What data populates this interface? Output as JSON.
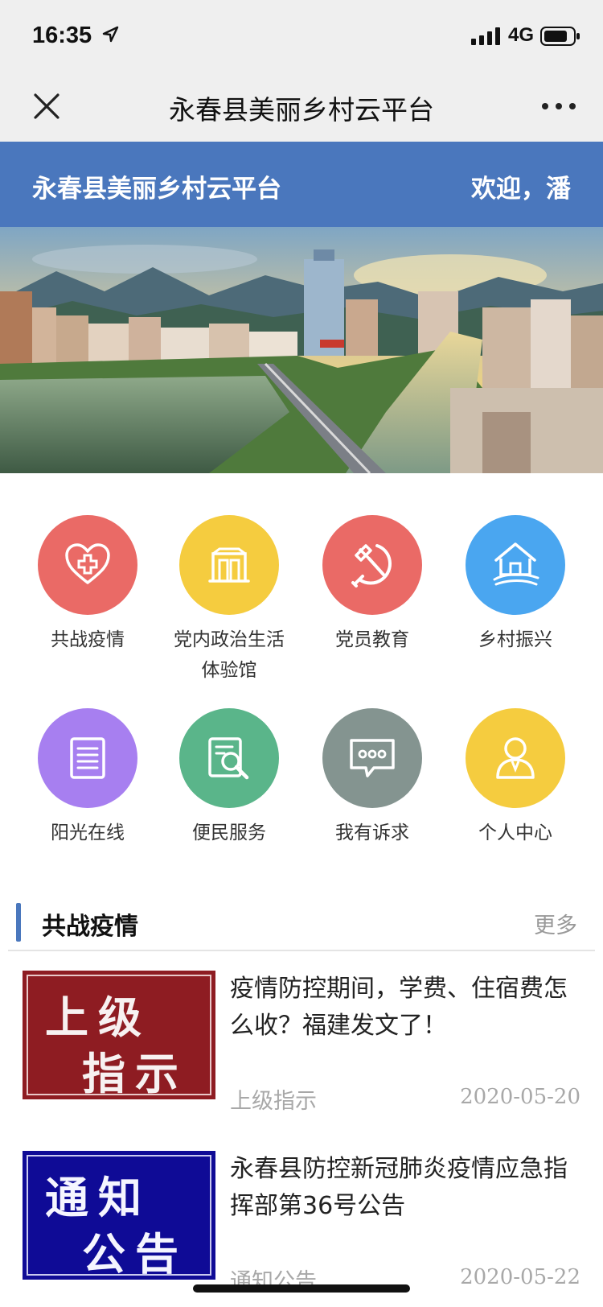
{
  "status_bar": {
    "time": "16:35",
    "network": "4G"
  },
  "nav": {
    "title": "永春县美丽乡村云平台"
  },
  "header": {
    "title": "永春县美丽乡村云平台",
    "welcome": "欢迎，潘"
  },
  "grid": {
    "items": [
      {
        "label": "共战疫情",
        "color": "#ea6a66",
        "icon": "heart-plus-icon"
      },
      {
        "label": "党内政治生活体验馆",
        "color": "#f5cc3f",
        "icon": "building-icon"
      },
      {
        "label": "党员教育",
        "color": "#ea6a66",
        "icon": "hammer-sickle-icon"
      },
      {
        "label": "乡村振兴",
        "color": "#4aa6f0",
        "icon": "house-icon"
      },
      {
        "label": "阳光在线",
        "color": "#a77ff0",
        "icon": "document-icon"
      },
      {
        "label": "便民服务",
        "color": "#5ab58a",
        "icon": "search-doc-icon"
      },
      {
        "label": "我有诉求",
        "color": "#849490",
        "icon": "chat-icon"
      },
      {
        "label": "个人中心",
        "color": "#f5cc3f",
        "icon": "person-icon"
      }
    ]
  },
  "section": {
    "title": "共战疫情",
    "more": "更多"
  },
  "news": [
    {
      "thumb_text_1": "上级",
      "thumb_text_2": "指示",
      "title": "疫情防控期间，学费、住宿费怎么收？福建发文了！",
      "category": "上级指示",
      "date": "2020-05-20",
      "thumb_color": "#8e1c22"
    },
    {
      "thumb_text_1": "通知",
      "thumb_text_2": "公告",
      "title": "永春县防控新冠肺炎疫情应急指挥部第36号公告",
      "category": "通知公告",
      "date": "2020-05-22",
      "thumb_color": "#0f0b96"
    }
  ]
}
